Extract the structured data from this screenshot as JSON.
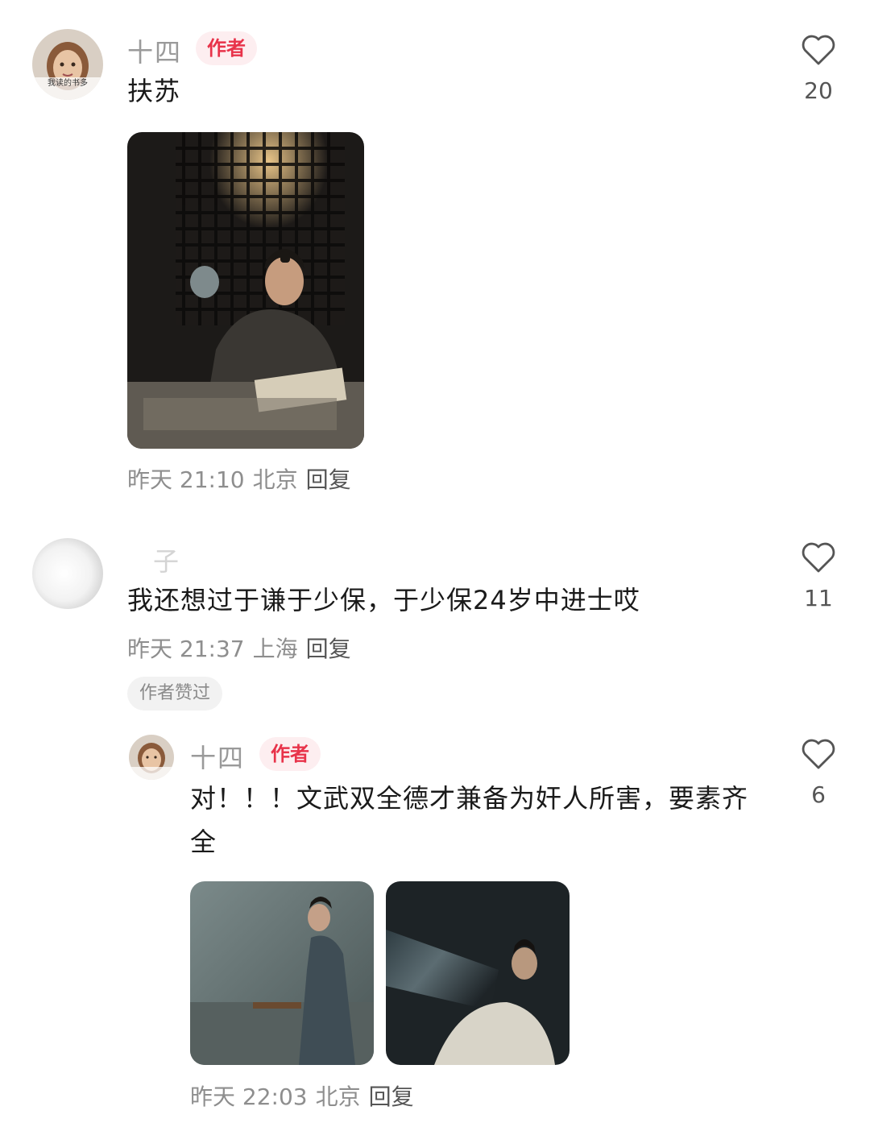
{
  "comments": [
    {
      "author": "十四",
      "badge": "作者",
      "avatar_caption": "我读的书多",
      "text": "扶苏",
      "time": "昨天 21:10",
      "location": "北京",
      "reply_label": "回复",
      "likes": "20",
      "heart_icon": "heart-outline-icon"
    },
    {
      "author": "子",
      "text": "我还想过于谦于少保，于少保24岁中进士哎",
      "time": "昨天 21:37",
      "location": "上海",
      "reply_label": "回复",
      "likes": "11",
      "author_liked": "作者赞过",
      "heart_icon": "heart-outline-icon"
    }
  ],
  "reply": {
    "author": "十四",
    "badge": "作者",
    "text": "对！！！文武双全德才兼备为奸人所害，要素齐全",
    "time": "昨天 22:03",
    "location": "北京",
    "reply_label": "回复",
    "likes": "6",
    "heart_icon": "heart-outline-icon"
  },
  "colors": {
    "badge_text": "#e8334a",
    "badge_bg": "#fdeef0",
    "meta_text": "#8e8e8e"
  }
}
